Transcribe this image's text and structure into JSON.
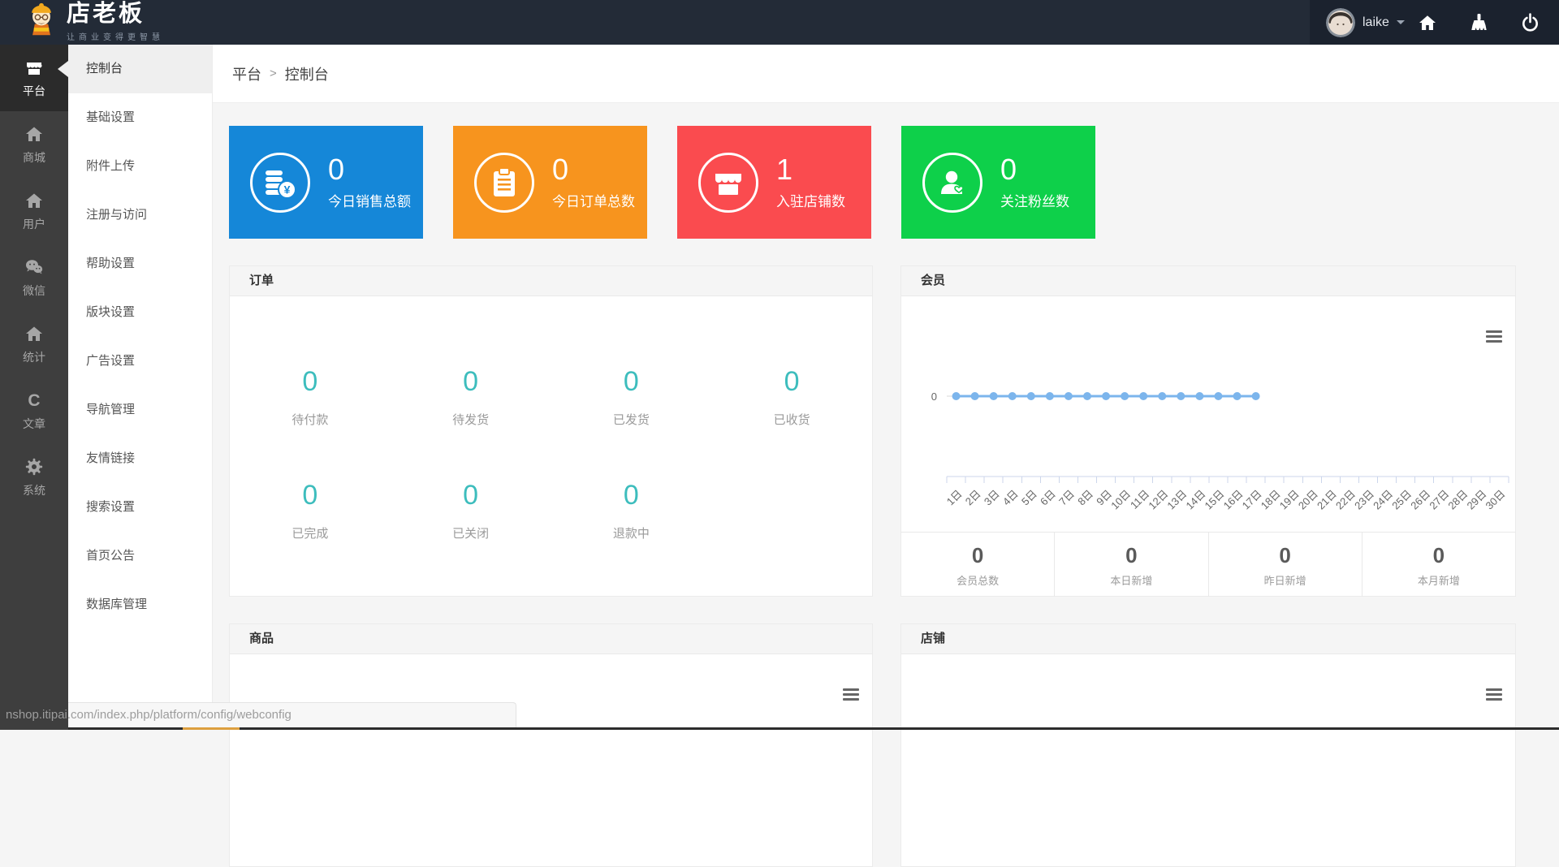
{
  "header": {
    "logo_title": "店老板",
    "logo_subtitle": "让商业变得更智慧",
    "username": "laike",
    "action_icons": [
      "home-icon",
      "brush-icon",
      "power-icon"
    ]
  },
  "icon_sidebar": {
    "active_index": 0,
    "items": [
      {
        "label": "平台",
        "icon": "storefront-icon"
      },
      {
        "label": "商城",
        "icon": "home-icon"
      },
      {
        "label": "用户",
        "icon": "home-icon"
      },
      {
        "label": "微信",
        "icon": "wechat-icon"
      },
      {
        "label": "统计",
        "icon": "home-icon"
      },
      {
        "label": "文章",
        "icon": "c-icon"
      },
      {
        "label": "系统",
        "icon": "gear-icon"
      }
    ]
  },
  "menu_sidebar": {
    "active_index": 0,
    "items": [
      "控制台",
      "基础设置",
      "附件上传",
      "注册与访问",
      "帮助设置",
      "版块设置",
      "广告设置",
      "导航管理",
      "友情链接",
      "搜索设置",
      "首页公告",
      "数据库管理"
    ]
  },
  "breadcrumb": {
    "items": [
      "平台",
      "控制台"
    ],
    "separator": ">"
  },
  "stat_cards": [
    {
      "value": "0",
      "label": "今日销售总额",
      "color": "#1587d8",
      "icon": "coins-yen-icon"
    },
    {
      "value": "0",
      "label": "今日订单总数",
      "color": "#f7941e",
      "icon": "clipboard-icon"
    },
    {
      "value": "1",
      "label": "入驻店铺数",
      "color": "#fa4b4f",
      "icon": "storefront-icon"
    },
    {
      "value": "0",
      "label": "关注粉丝数",
      "color": "#0ed04a",
      "icon": "fan-heart-icon"
    }
  ],
  "orders_panel": {
    "title": "订单",
    "value_color": "#3dbdbd",
    "stats": [
      {
        "value": "0",
        "label": "待付款"
      },
      {
        "value": "0",
        "label": "待发货"
      },
      {
        "value": "0",
        "label": "已发货"
      },
      {
        "value": "0",
        "label": "已收货"
      },
      {
        "value": "0",
        "label": "已完成"
      },
      {
        "value": "0",
        "label": "已关闭"
      },
      {
        "value": "0",
        "label": "退款中"
      }
    ]
  },
  "members_panel": {
    "title": "会员",
    "stats": [
      {
        "value": "0",
        "label": "会员总数"
      },
      {
        "value": "0",
        "label": "本日新增"
      },
      {
        "value": "0",
        "label": "昨日新增"
      },
      {
        "value": "0",
        "label": "本月新增"
      }
    ]
  },
  "chart_data": {
    "type": "line",
    "title": "",
    "x": [
      "1日",
      "2日",
      "3日",
      "4日",
      "5日",
      "6日",
      "7日",
      "8日",
      "9日",
      "10日",
      "11日",
      "12日",
      "13日",
      "14日",
      "15日",
      "16日",
      "17日",
      "18日",
      "19日",
      "20日",
      "21日",
      "22日",
      "23日",
      "24日",
      "25日",
      "26日",
      "27日",
      "28日",
      "29日",
      "30日"
    ],
    "series": [
      {
        "name": "会员",
        "values": [
          0,
          0,
          0,
          0,
          0,
          0,
          0,
          0,
          0,
          0,
          0,
          0,
          0,
          0,
          0,
          0,
          0,
          null,
          null,
          null,
          null,
          null,
          null,
          null,
          null,
          null,
          null,
          null,
          null,
          null
        ]
      }
    ],
    "y_tick_labels": [
      "0"
    ],
    "x_label_rotation": -45,
    "line_color": "#7cb5ec",
    "axis_color": "#ccd6eb",
    "tick_label_color": "#666666",
    "legend": "none",
    "grid": "off"
  },
  "products_panel": {
    "title": "商品"
  },
  "shops_panel": {
    "title": "店铺"
  },
  "status_bar": {
    "url": "nshop.itipai.com/index.php/platform/config/webconfig"
  }
}
